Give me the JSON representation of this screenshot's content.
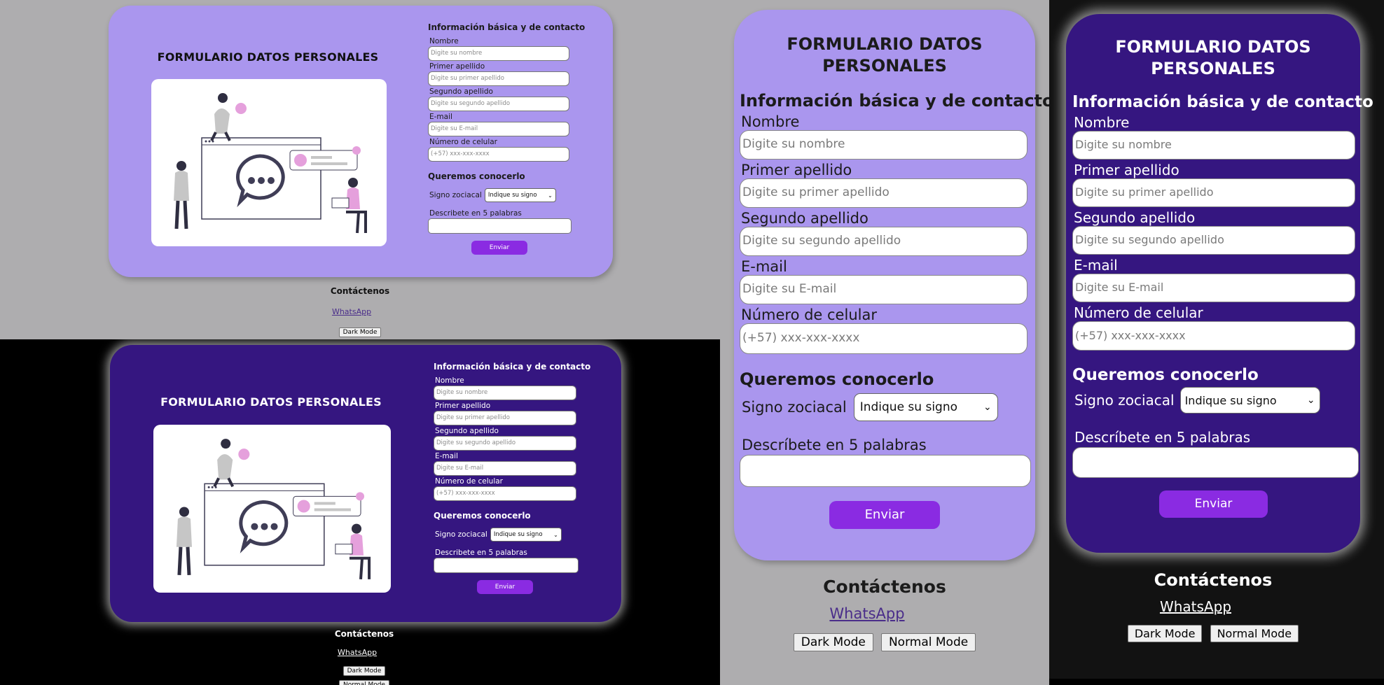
{
  "form": {
    "title": "FORMULARIO DATOS PERSONALES",
    "title_line1": "FORMULARIO DATOS",
    "title_line2": "PERSONALES",
    "section_basic": "Información básica y de contacto",
    "fields": [
      {
        "label": "Nombre",
        "placeholder": "Digite su nombre"
      },
      {
        "label": "Primer apellido",
        "placeholder": "Digite su primer apellido"
      },
      {
        "label": "Segundo apellido",
        "placeholder": "Digite su segundo apellido"
      },
      {
        "label": "E-mail",
        "placeholder": "Digite su E-mail"
      },
      {
        "label": "Número de celular",
        "placeholder": "(+57) xxx-xxx-xxxx"
      }
    ],
    "section_know": "Queremos conocerlo",
    "zodiac_label": "Signo zociacal",
    "zodiac_selected": "Indique su signo",
    "describe_label_wide": "Describete en 5 palabras",
    "describe_label_mobile": "Descríbete en 5 palabras",
    "submit": "Enviar"
  },
  "contact": {
    "heading": "Contáctenos",
    "whatsapp": "WhatsApp",
    "dark_mode": "Dark Mode",
    "normal_mode": "Normal Mode"
  },
  "icons": {
    "select_arrow": "chevron-down-icon",
    "illustration": "chat-bubble-people-illustration"
  },
  "colors": {
    "card_light": "#aa96ee",
    "card_dark": "#351680",
    "button": "#8a2be2",
    "bg_light": "#aeadaf",
    "bg_dark": "#000000",
    "link_light": "#4a2d8a",
    "link_dark": "#ffffff"
  }
}
